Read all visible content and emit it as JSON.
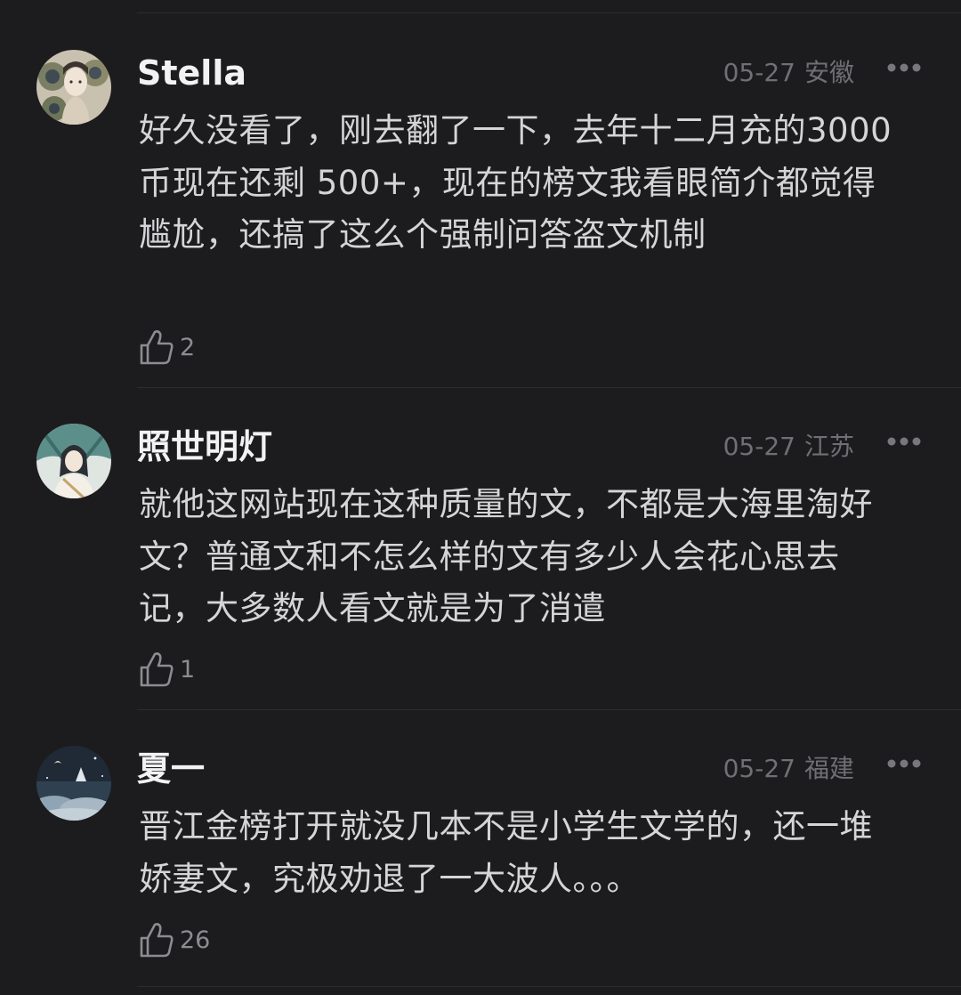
{
  "comments": [
    {
      "author": "Stella",
      "date": "05-27",
      "location": "安徽",
      "text": "好久没看了，刚去翻了一下，去年十二月充的3000 币现在还剩 500+，现在的榜文我看眼简介都觉得尴尬，还搞了这么个强制问答盗文机制",
      "likes": "2",
      "avatar_icon": "avatar-girl-with-peacock-feathers-icon"
    },
    {
      "author": "照世明灯",
      "date": "05-27",
      "location": "江苏",
      "text": "就他这网站现在这种质量的文，不都是大海里淘好文？普通文和不怎么样的文有多少人会花心思去记，大多数人看文就是为了消遣",
      "likes": "1",
      "avatar_icon": "avatar-painted-swordsman-icon"
    },
    {
      "author": "夏一",
      "date": "05-27",
      "location": "福建",
      "text": "晋江金榜打开就没几本不是小学生文学的，还一堆娇妻文，究极劝退了一大波人。。。",
      "likes": "26",
      "avatar_icon": "avatar-night-sky-clouds-icon"
    }
  ],
  "icons": {
    "like": "thumbs-up-outline-icon",
    "more": "more-horizontal-dots-icon"
  },
  "colors": {
    "background": "#1c1c1e",
    "author": "#f2f2f4",
    "text": "#d5d5d8",
    "meta": "#6f6f74",
    "divider": "#2c2c2f"
  }
}
